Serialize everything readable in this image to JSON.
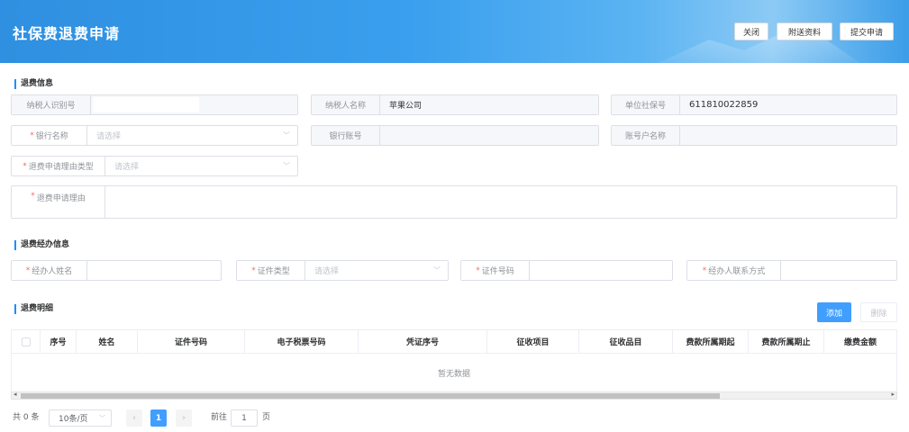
{
  "header": {
    "title": "社保费退费申请",
    "buttons": {
      "close": "关闭",
      "attach": "附送资料",
      "submit": "提交申请"
    }
  },
  "refund_info": {
    "section_title": "退费信息",
    "taxpayer_id": {
      "label": "纳税人识别号",
      "value": ""
    },
    "taxpayer_name": {
      "label": "纳税人名称",
      "value": "苹果公司"
    },
    "unit_si_no": {
      "label": "单位社保号",
      "value": "611810022859"
    },
    "bank_name": {
      "label": "银行名称",
      "placeholder": "请选择"
    },
    "bank_account": {
      "label": "银行账号",
      "value": ""
    },
    "account_name": {
      "label": "账号户名称",
      "value": ""
    },
    "reason_type": {
      "label": "退费申请理由类型",
      "placeholder": "请选择"
    },
    "reason": {
      "label": "退费申请理由",
      "value": ""
    }
  },
  "handler_info": {
    "section_title": "退费经办信息",
    "handler_name": {
      "label": "经办人姓名"
    },
    "id_type": {
      "label": "证件类型",
      "placeholder": "请选择"
    },
    "id_number": {
      "label": "证件号码"
    },
    "contact": {
      "label": "经办人联系方式"
    }
  },
  "details": {
    "section_title": "退费明细",
    "add_label": "添加",
    "delete_label": "删除",
    "columns": [
      "序号",
      "姓名",
      "证件号码",
      "电子税票号码",
      "凭证序号",
      "征收项目",
      "征收品目",
      "费款所属期起",
      "费款所属期止",
      "缴费金额"
    ],
    "empty_text": "暂无数据"
  },
  "pagination": {
    "total": "共 0 条",
    "page_size": "10条/页",
    "current_page": "1",
    "goto_label": "前往",
    "goto_value": "1",
    "page_unit": "页"
  },
  "colors": {
    "accent": "#409eff",
    "header_blue": "#3a9fee",
    "required": "#f56c6c"
  }
}
